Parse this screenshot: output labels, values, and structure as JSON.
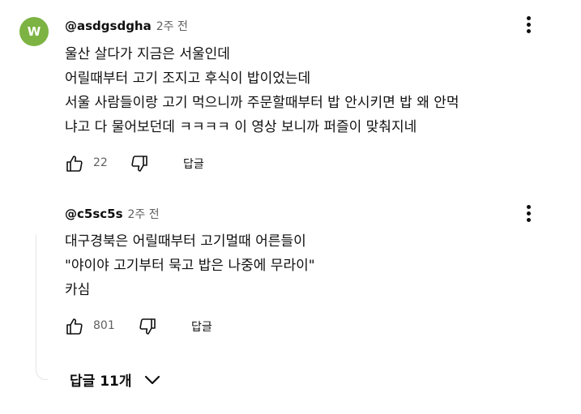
{
  "comment": {
    "avatar_letter": "W",
    "avatar_color": "#7cb342",
    "author": "@asdgsdgha",
    "time": "2주 전",
    "lines": [
      "울산 살다가 지금은 서울인데",
      "어릴때부터 고기 조지고 후식이 밥이었는데",
      "서울 사람들이랑 고기 먹으니까 주문할때부터 밥 안시키면 밥 왜 안먹",
      "냐고 다 물어보던데 ㅋㅋㅋㅋ 이 영상 보니까 퍼즐이 맞춰지네"
    ],
    "likes": "22",
    "reply_label": "답글"
  },
  "reply": {
    "author": "@c5sc5s",
    "time": "2주 전",
    "lines": [
      "대구경북은 어릴때부터 고기멀때 어른들이",
      "\"야이야 고기부터 묵고 밥은 나중에 무라이\"",
      "카심"
    ],
    "likes": "801",
    "reply_label": "답글"
  },
  "more_replies_label": "답글 11개",
  "icons": {
    "like": "thumbs-up-icon",
    "dislike": "thumbs-down-icon",
    "menu": "kebab-menu-icon",
    "expand": "chevron-down-icon"
  }
}
